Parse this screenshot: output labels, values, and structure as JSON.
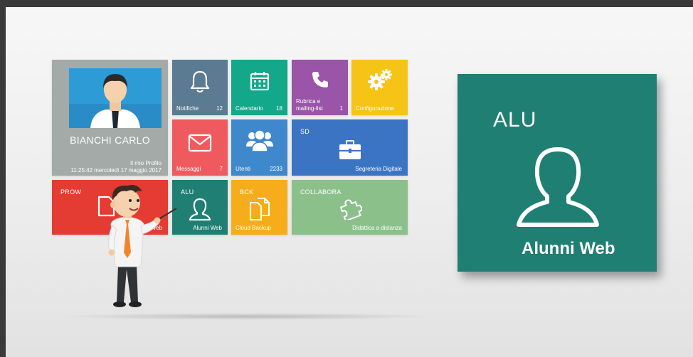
{
  "profile": {
    "name": "BIANCHI CARLO",
    "link_label": "Il mio Profilo",
    "datetime": "11:25:42 mercoledì 17 maggio 2017"
  },
  "tiles": {
    "notifiche": {
      "label": "Notifiche",
      "count": "12"
    },
    "calendario": {
      "label": "Calendario",
      "count": "18"
    },
    "rubrica": {
      "label_line1": "Rubrica e",
      "label_line2": "mailing-list",
      "count": "1"
    },
    "configurazione": {
      "label": "Configurazione"
    },
    "messaggi": {
      "label": "Messaggi",
      "count": "7"
    },
    "utenti": {
      "label": "Utenti",
      "count": "2233"
    },
    "segreteria": {
      "abbr": "SD",
      "label": "Segreteria Digitale"
    },
    "protocollo": {
      "abbr": "PROW",
      "label": "...ollo Web"
    },
    "alunni": {
      "abbr": "ALU",
      "label": "Alunni Web"
    },
    "backup": {
      "abbr": "BCK",
      "label": "Cloud Backup"
    },
    "collabora": {
      "abbr": "COLLABORA",
      "label": "Didattica a distanza"
    }
  },
  "featured": {
    "abbr": "ALU",
    "label": "Alunni Web"
  },
  "colors": {
    "profile": "#a3aaa7",
    "notifiche": "#5b7b93",
    "calendario": "#12a889",
    "rubrica": "#9a55a8",
    "configurazione": "#f6c417",
    "messaggi": "#ef5a5f",
    "utenti": "#3f88cc",
    "segreteria": "#3c74c4",
    "protocollo": "#e43b33",
    "alunni": "#1f7f72",
    "backup": "#f6ad1b",
    "collabora": "#8bc08b"
  }
}
